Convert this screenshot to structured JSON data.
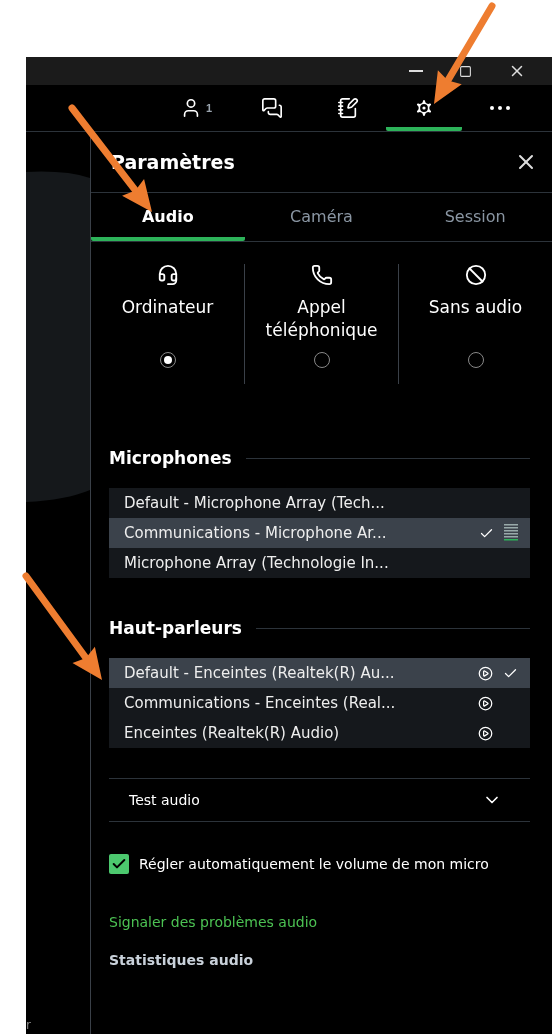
{
  "window": {
    "controls": [
      {
        "kind": "minimize"
      },
      {
        "kind": "maximize"
      },
      {
        "kind": "close"
      }
    ]
  },
  "toolbar": {
    "items": [
      {
        "kind": "participants",
        "badge": "1",
        "selected": false
      },
      {
        "kind": "chat",
        "selected": false
      },
      {
        "kind": "notes",
        "selected": false
      },
      {
        "kind": "settings",
        "selected": true
      },
      {
        "kind": "more",
        "selected": false
      }
    ]
  },
  "side_fragment": "r",
  "panel": {
    "title": "Paramètres",
    "tabs": [
      {
        "label": "Audio",
        "selected": true
      },
      {
        "label": "Caméra",
        "selected": false
      },
      {
        "label": "Session",
        "selected": false
      }
    ],
    "audio_modes": [
      {
        "kind": "computer",
        "label": "Ordinateur",
        "selected": true
      },
      {
        "kind": "phone",
        "label": "Appel téléphonique",
        "selected": false
      },
      {
        "kind": "none",
        "label": "Sans audio",
        "selected": false
      }
    ],
    "microphones": {
      "heading": "Microphones",
      "devices": [
        {
          "name": "Default - Microphone Array (Tech...",
          "selected": false
        },
        {
          "name": "Communications - Microphone Ar...",
          "selected": true
        },
        {
          "name": "Microphone Array (Technologie In...",
          "selected": false
        }
      ]
    },
    "speakers": {
      "heading": "Haut-parleurs",
      "devices": [
        {
          "name": "Default - Enceintes (Realtek(R) Au...",
          "selected": true
        },
        {
          "name": "Communications - Enceintes (Real...",
          "selected": false
        },
        {
          "name": "Enceintes (Realtek(R) Audio)",
          "selected": false
        }
      ]
    },
    "test_audio": {
      "label": "Test audio",
      "expanded": false
    },
    "auto_volume": {
      "label": "Régler automatiquement le volume de mon micro",
      "checked": true
    },
    "report_link": "Signaler des problèmes audio",
    "stats": "Statistiques audio"
  }
}
